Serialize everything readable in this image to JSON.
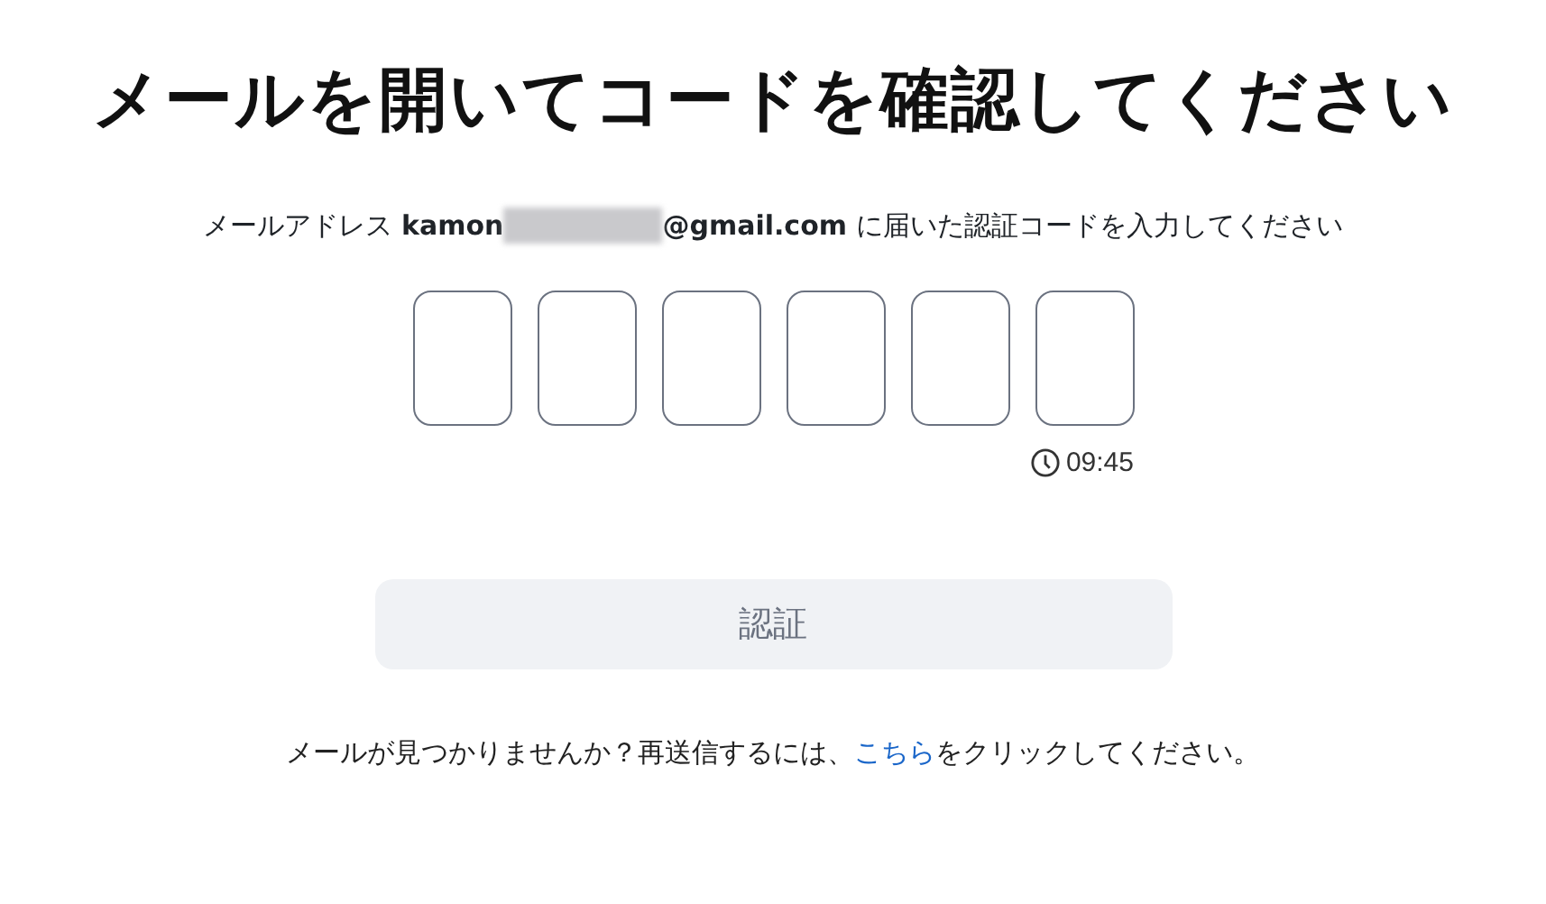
{
  "title": "メールを開いてコードを確認してください",
  "instruction": {
    "before": "メールアドレス **kamon**",
    "after": "**@gmail.com** に届いた認証コードを入力してください",
    "redacted": true
  },
  "code_boxes": [
    {
      "kind": "empty"
    },
    {
      "kind": "empty"
    },
    {
      "kind": "empty"
    },
    {
      "kind": "empty"
    },
    {
      "kind": "empty"
    },
    {
      "kind": "empty"
    }
  ],
  "timer": "09:45",
  "verify_button": {
    "label": "認証",
    "disabled": true
  },
  "resend": {
    "before": "メールが見つかりませんか？再送信するには、",
    "link": "こちら",
    "after": "をクリックしてください。"
  }
}
